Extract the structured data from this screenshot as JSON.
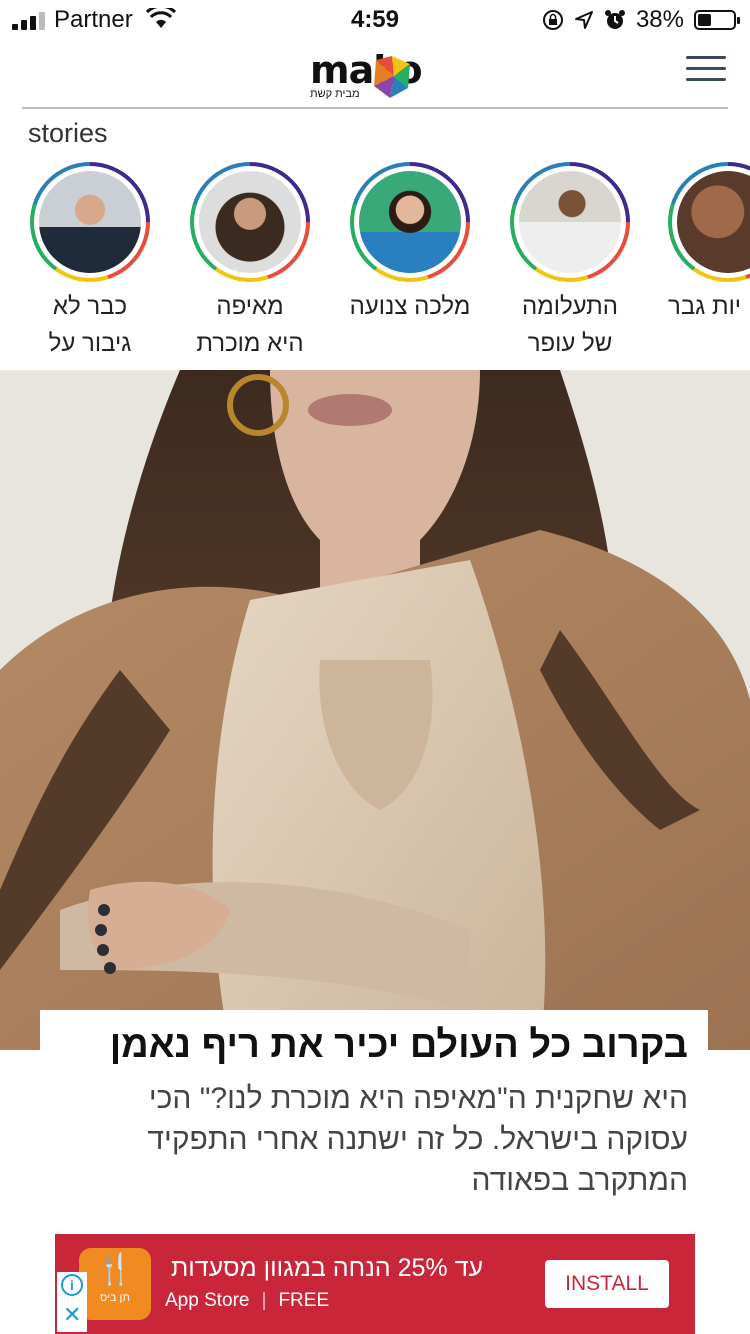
{
  "status_bar": {
    "carrier": "Partner",
    "time": "4:59",
    "battery": "38%",
    "battery_level": 0.38
  },
  "header": {
    "logo_text": "mako",
    "logo_sub": "מבית קשת",
    "menu_icon": "hamburger-icon"
  },
  "stories": {
    "title": "stories",
    "items": [
      {
        "line1": "כבר לא",
        "line2": "גיבור על"
      },
      {
        "line1": "מאיפה",
        "line2": "היא מוכרת"
      },
      {
        "line1": "מלכה צנועה",
        "line2": ""
      },
      {
        "line1": "התעלומה",
        "line2": "של עופר"
      },
      {
        "line1": "יות גבר",
        "line2": ""
      }
    ]
  },
  "article": {
    "headline": "בקרוב כל העולם יכיר את ריף נאמן",
    "summary": "היא שחקנית ה\"מאיפה היא מוכרת לנו?\" הכי עסוקה בישראל. כל זה ישתנה אחרי התפקיד המתקרב בפאודה"
  },
  "ad": {
    "title": "עד 25% הנחה במגוון מסעדות",
    "store": "App Store",
    "price": "FREE",
    "install_label": "INSTALL",
    "brand": "תן ביס",
    "bg_color": "#c9263a",
    "icon_color": "#f28a22"
  }
}
